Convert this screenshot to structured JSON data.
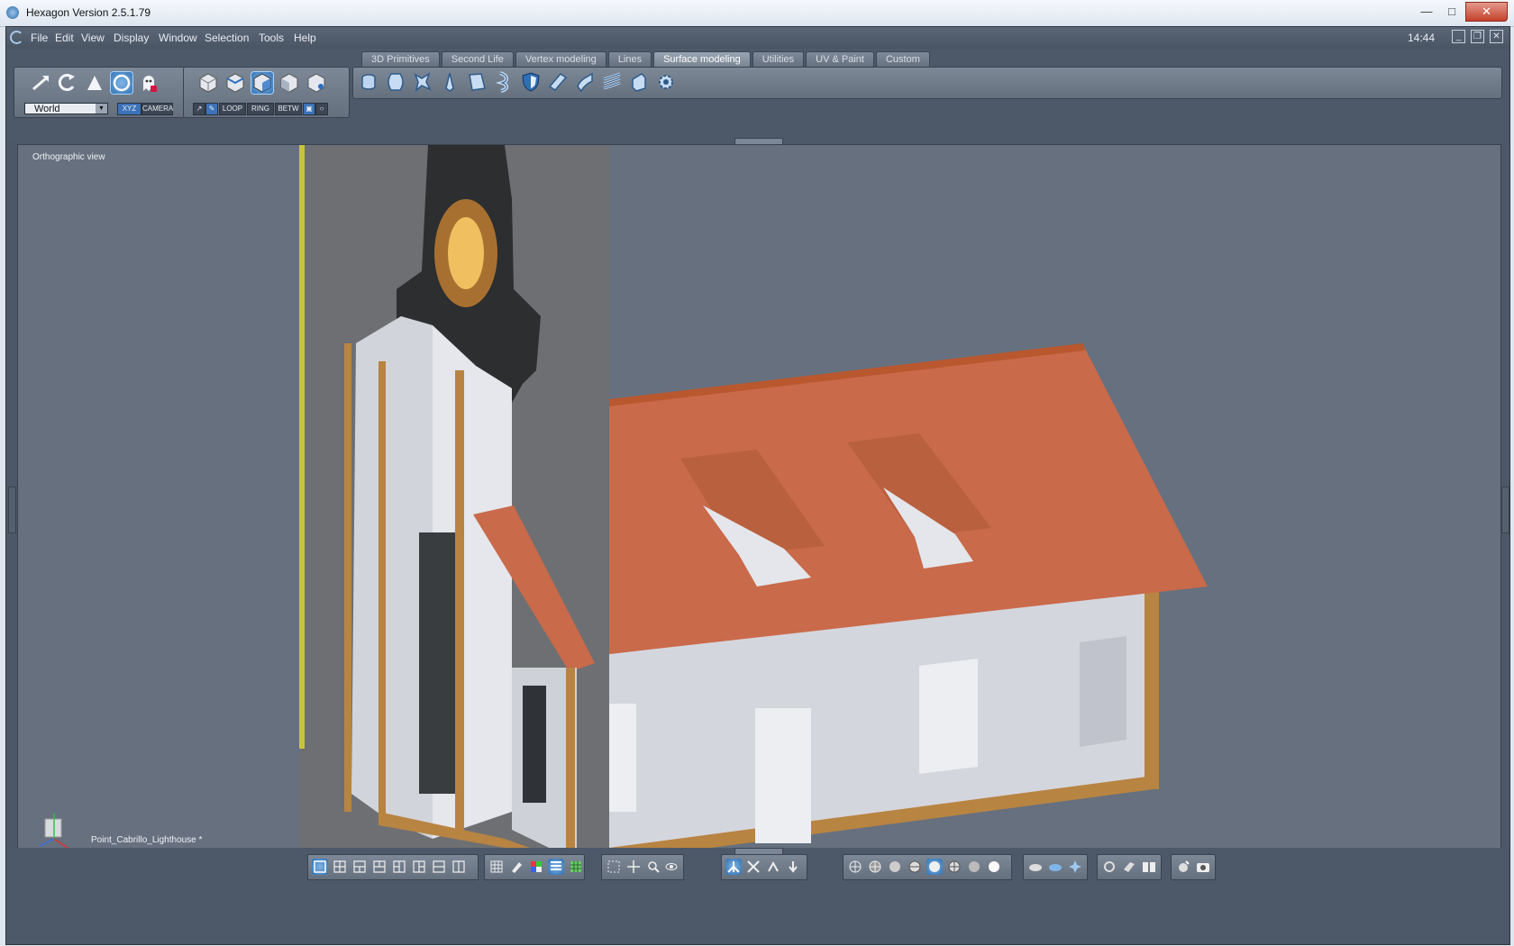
{
  "window": {
    "title": "Hexagon Version 2.5.1.79",
    "min": "—",
    "max": "□",
    "close": "✕"
  },
  "menu": {
    "items": [
      "File",
      "Edit",
      "View",
      "Display",
      "Window",
      "Selection",
      "Tools",
      "Help"
    ],
    "clock": "14:44"
  },
  "tabs": [
    {
      "label": "3D Primitives",
      "active": false
    },
    {
      "label": "Second Life",
      "active": false
    },
    {
      "label": "Vertex modeling",
      "active": false
    },
    {
      "label": "Lines",
      "active": false
    },
    {
      "label": "Surface modeling",
      "active": true
    },
    {
      "label": "Utilities",
      "active": false
    },
    {
      "label": "UV & Paint",
      "active": false
    },
    {
      "label": "Custom",
      "active": false
    }
  ],
  "coord_panel": {
    "space": "World",
    "xyz_label": "XYZ",
    "camera_label": "CAMERA",
    "tools": [
      "move-tool-icon",
      "rotate-tool-icon",
      "scale-tool-icon",
      "universal-manipulator-icon",
      "ghost-icon"
    ]
  },
  "select_panel": {
    "modes": [
      "object-select-icon",
      "vertex-select-icon",
      "edge-select-icon",
      "face-select-icon",
      "auto-select-icon"
    ],
    "loop_label": "LOOP",
    "ring_label": "RING",
    "betw_label": "BETW"
  },
  "surface_tools": [
    "extrude-icon",
    "loft-icon",
    "revolve-icon",
    "sweep-icon",
    "coons-patch-icon",
    "bend-icon",
    "shield-icon",
    "slab-icon",
    "surface-skin-icon",
    "stairs-icon",
    "shell-icon",
    "gear-icon"
  ],
  "viewport": {
    "label": "Orthographic view",
    "object_name": "Point_Cabrillo_Lighthouse *"
  },
  "colors": {
    "roof": "#c96a4a",
    "wall": "#d6d8df",
    "trim": "#b98748",
    "background": "#66707f"
  }
}
